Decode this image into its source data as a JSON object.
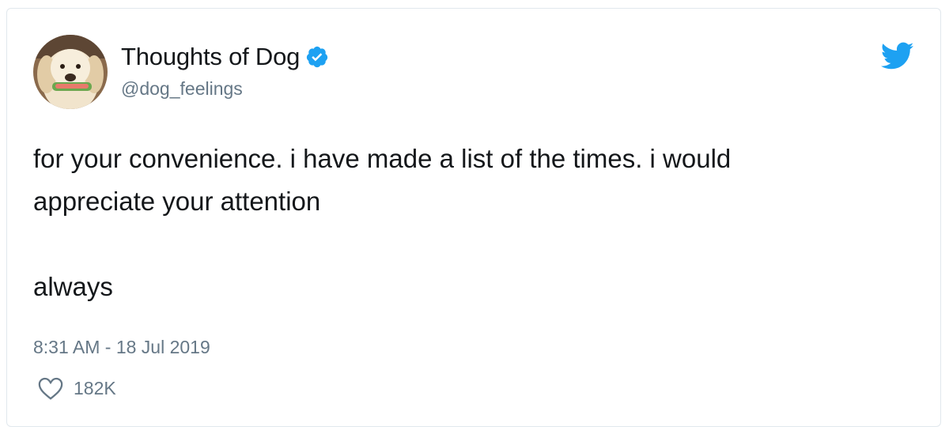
{
  "tweet": {
    "author_name": "Thoughts of Dog",
    "author_handle": "@dog_feelings",
    "verified": true,
    "text": "for your convenience. i have made a list of the times. i would\nappreciate your attention\n\nalways",
    "timestamp": "8:31 AM - 18 Jul 2019",
    "like_count": "182K"
  },
  "icons": {
    "verified": "verified-badge-icon",
    "brand": "twitter-bird-icon",
    "like": "heart-icon"
  },
  "colors": {
    "brand_blue": "#1da1f2",
    "text_primary": "#14171a",
    "text_secondary": "#657786",
    "card_border": "#e1e8ed"
  }
}
